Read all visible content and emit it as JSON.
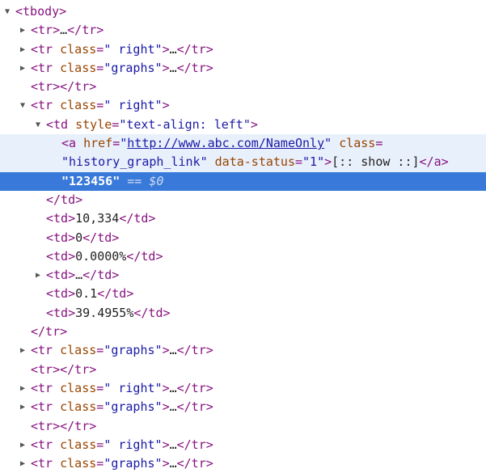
{
  "elements_panel": {
    "lines": [
      {
        "indent": 0,
        "toggle": "expanded",
        "parts": [
          [
            "tag",
            "<tbody>"
          ]
        ]
      },
      {
        "indent": 1,
        "toggle": "collapsed",
        "parts": [
          [
            "tag",
            "<tr>"
          ],
          [
            "txt",
            "…"
          ],
          [
            "tag",
            "</tr>"
          ]
        ]
      },
      {
        "indent": 1,
        "toggle": "collapsed",
        "parts": [
          [
            "tag",
            "<tr "
          ],
          [
            "attr",
            "class"
          ],
          [
            "tag",
            "="
          ],
          [
            "val",
            "\" right\""
          ],
          [
            "tag",
            ">"
          ],
          [
            "txt",
            "…"
          ],
          [
            "tag",
            "</tr>"
          ]
        ]
      },
      {
        "indent": 1,
        "toggle": "collapsed",
        "parts": [
          [
            "tag",
            "<tr "
          ],
          [
            "attr",
            "class"
          ],
          [
            "tag",
            "="
          ],
          [
            "val",
            "\"graphs\""
          ],
          [
            "tag",
            ">"
          ],
          [
            "txt",
            "…"
          ],
          [
            "tag",
            "</tr>"
          ]
        ]
      },
      {
        "indent": 1,
        "toggle": "none",
        "parts": [
          [
            "tag",
            "<tr></tr>"
          ]
        ]
      },
      {
        "indent": 1,
        "toggle": "expanded",
        "parts": [
          [
            "tag",
            "<tr "
          ],
          [
            "attr",
            "class"
          ],
          [
            "tag",
            "="
          ],
          [
            "val",
            "\" right\""
          ],
          [
            "tag",
            ">"
          ]
        ]
      },
      {
        "indent": 2,
        "toggle": "expanded",
        "parts": [
          [
            "tag",
            "<td "
          ],
          [
            "attr",
            "style"
          ],
          [
            "tag",
            "="
          ],
          [
            "val",
            "\"text-align: left\""
          ],
          [
            "tag",
            ">"
          ]
        ]
      },
      {
        "indent": 3,
        "toggle": "none",
        "highlight": "soft",
        "parts": [
          [
            "tag",
            "<a "
          ],
          [
            "attr",
            "href"
          ],
          [
            "tag",
            "="
          ],
          [
            "val",
            "\""
          ],
          [
            "link",
            "http://www.abc.com/NameOnly"
          ],
          [
            "val",
            "\""
          ],
          [
            "txt",
            " "
          ],
          [
            "attr",
            "class"
          ],
          [
            "tag",
            "="
          ]
        ]
      },
      {
        "indent": 3,
        "toggle": "none",
        "highlight": "soft",
        "parts": [
          [
            "val",
            "\"history_graph_link\""
          ],
          [
            "txt",
            " "
          ],
          [
            "attr",
            "data-status"
          ],
          [
            "tag",
            "="
          ],
          [
            "val",
            "\"1\""
          ],
          [
            "tag",
            ">"
          ],
          [
            "txt",
            "[:: show ::]"
          ],
          [
            "tag",
            "</a>"
          ]
        ]
      },
      {
        "indent": 3,
        "toggle": "none",
        "highlight": "strong",
        "parts": [
          [
            "txt",
            "\"123456\""
          ],
          [
            "dim",
            " == $0"
          ]
        ]
      },
      {
        "indent": 2,
        "toggle": "none",
        "parts": [
          [
            "tag",
            "</td>"
          ]
        ]
      },
      {
        "indent": 2,
        "toggle": "none",
        "parts": [
          [
            "tag",
            "<td>"
          ],
          [
            "txt",
            "10,334"
          ],
          [
            "tag",
            "</td>"
          ]
        ]
      },
      {
        "indent": 2,
        "toggle": "none",
        "parts": [
          [
            "tag",
            "<td>"
          ],
          [
            "txt",
            "0"
          ],
          [
            "tag",
            "</td>"
          ]
        ]
      },
      {
        "indent": 2,
        "toggle": "none",
        "parts": [
          [
            "tag",
            "<td>"
          ],
          [
            "txt",
            "0.0000%"
          ],
          [
            "tag",
            "</td>"
          ]
        ]
      },
      {
        "indent": 2,
        "toggle": "collapsed",
        "parts": [
          [
            "tag",
            "<td>"
          ],
          [
            "txt",
            "…"
          ],
          [
            "tag",
            "</td>"
          ]
        ]
      },
      {
        "indent": 2,
        "toggle": "none",
        "parts": [
          [
            "tag",
            "<td>"
          ],
          [
            "txt",
            "0.1"
          ],
          [
            "tag",
            "</td>"
          ]
        ]
      },
      {
        "indent": 2,
        "toggle": "none",
        "parts": [
          [
            "tag",
            "<td>"
          ],
          [
            "txt",
            "39.4955%"
          ],
          [
            "tag",
            "</td>"
          ]
        ]
      },
      {
        "indent": 1,
        "toggle": "none",
        "parts": [
          [
            "tag",
            "</tr>"
          ]
        ]
      },
      {
        "indent": 1,
        "toggle": "collapsed",
        "parts": [
          [
            "tag",
            "<tr "
          ],
          [
            "attr",
            "class"
          ],
          [
            "tag",
            "="
          ],
          [
            "val",
            "\"graphs\""
          ],
          [
            "tag",
            ">"
          ],
          [
            "txt",
            "…"
          ],
          [
            "tag",
            "</tr>"
          ]
        ]
      },
      {
        "indent": 1,
        "toggle": "none",
        "parts": [
          [
            "tag",
            "<tr></tr>"
          ]
        ]
      },
      {
        "indent": 1,
        "toggle": "collapsed",
        "parts": [
          [
            "tag",
            "<tr "
          ],
          [
            "attr",
            "class"
          ],
          [
            "tag",
            "="
          ],
          [
            "val",
            "\" right\""
          ],
          [
            "tag",
            ">"
          ],
          [
            "txt",
            "…"
          ],
          [
            "tag",
            "</tr>"
          ]
        ]
      },
      {
        "indent": 1,
        "toggle": "collapsed",
        "parts": [
          [
            "tag",
            "<tr "
          ],
          [
            "attr",
            "class"
          ],
          [
            "tag",
            "="
          ],
          [
            "val",
            "\"graphs\""
          ],
          [
            "tag",
            ">"
          ],
          [
            "txt",
            "…"
          ],
          [
            "tag",
            "</tr>"
          ]
        ]
      },
      {
        "indent": 1,
        "toggle": "none",
        "parts": [
          [
            "tag",
            "<tr></tr>"
          ]
        ]
      },
      {
        "indent": 1,
        "toggle": "collapsed",
        "parts": [
          [
            "tag",
            "<tr "
          ],
          [
            "attr",
            "class"
          ],
          [
            "tag",
            "="
          ],
          [
            "val",
            "\" right\""
          ],
          [
            "tag",
            ">"
          ],
          [
            "txt",
            "…"
          ],
          [
            "tag",
            "</tr>"
          ]
        ]
      },
      {
        "indent": 1,
        "toggle": "collapsed",
        "parts": [
          [
            "tag",
            "<tr "
          ],
          [
            "attr",
            "class"
          ],
          [
            "tag",
            "="
          ],
          [
            "val",
            "\"graphs\""
          ],
          [
            "tag",
            ">"
          ],
          [
            "txt",
            "…"
          ],
          [
            "tag",
            "</tr>"
          ]
        ]
      }
    ],
    "toggle_glyphs": {
      "expanded": "▼",
      "collapsed": "▶",
      "none": ""
    },
    "colors": {
      "tag": "#881280",
      "attribute_name": "#994500",
      "attribute_value": "#1a1aa6",
      "selected_row": "#3879d9",
      "hover_row": "#e8f0fb"
    }
  }
}
